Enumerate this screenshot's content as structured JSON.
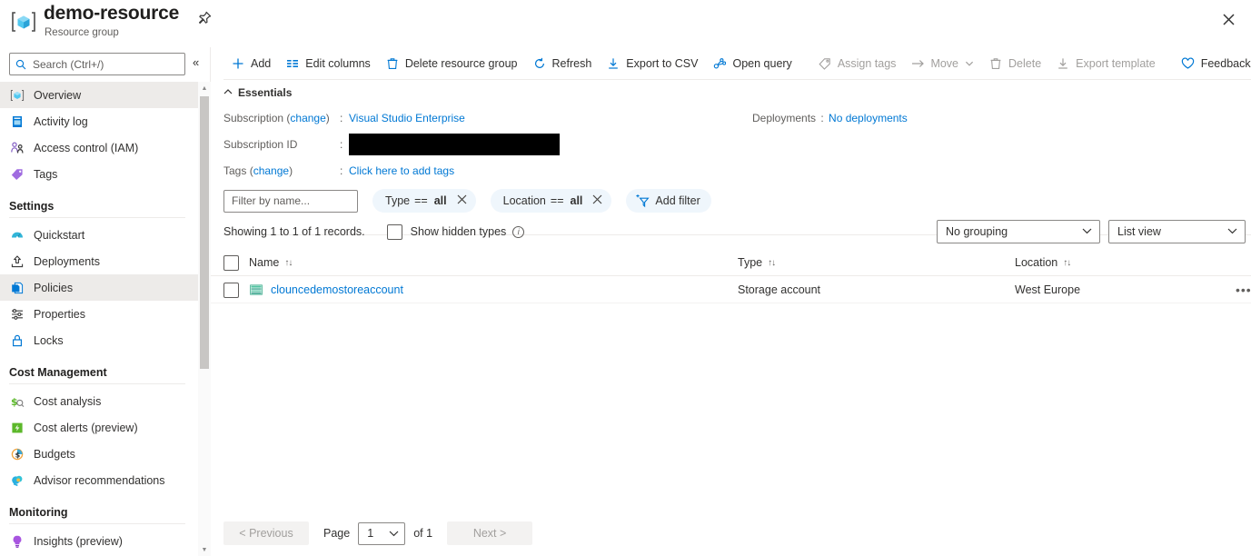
{
  "titlebar": {
    "title": "demo-resource",
    "subtitle": "Resource group",
    "pin_icon": "pin-icon",
    "close_icon": "close-icon",
    "resource_icon": "resource-group-icon"
  },
  "sidebar": {
    "search_placeholder": "Search (Ctrl+/)",
    "search_value": "",
    "collapse_label": "«",
    "items": [
      {
        "label": "Overview",
        "icon": "overview-icon",
        "active": true,
        "type": "item"
      },
      {
        "label": "Activity log",
        "icon": "activity-log-icon",
        "active": false,
        "type": "item"
      },
      {
        "label": "Access control (IAM)",
        "icon": "access-control-icon",
        "active": false,
        "type": "item"
      },
      {
        "label": "Tags",
        "icon": "tags-icon",
        "active": false,
        "type": "item"
      },
      {
        "label": "Settings",
        "type": "group"
      },
      {
        "label": "Quickstart",
        "icon": "quickstart-icon",
        "active": false,
        "type": "item"
      },
      {
        "label": "Deployments",
        "icon": "deployments-icon",
        "active": false,
        "type": "item"
      },
      {
        "label": "Policies",
        "icon": "policies-icon",
        "active": true,
        "type": "item"
      },
      {
        "label": "Properties",
        "icon": "properties-icon",
        "active": false,
        "type": "item"
      },
      {
        "label": "Locks",
        "icon": "locks-icon",
        "active": false,
        "type": "item"
      },
      {
        "label": "Cost Management",
        "type": "group"
      },
      {
        "label": "Cost analysis",
        "icon": "cost-analysis-icon",
        "active": false,
        "type": "item"
      },
      {
        "label": "Cost alerts (preview)",
        "icon": "cost-alerts-icon",
        "active": false,
        "type": "item"
      },
      {
        "label": "Budgets",
        "icon": "budgets-icon",
        "active": false,
        "type": "item"
      },
      {
        "label": "Advisor recommendations",
        "icon": "advisor-icon",
        "active": false,
        "type": "item"
      },
      {
        "label": "Monitoring",
        "type": "group"
      },
      {
        "label": "Insights (preview)",
        "icon": "insights-icon",
        "active": false,
        "type": "item"
      }
    ]
  },
  "toolbar": {
    "commands": [
      {
        "label": "Add",
        "icon": "plus-icon",
        "disabled": false
      },
      {
        "label": "Edit columns",
        "icon": "columns-icon",
        "disabled": false
      },
      {
        "label": "Delete resource group",
        "icon": "trash-icon",
        "disabled": false
      },
      {
        "label": "Refresh",
        "icon": "refresh-icon",
        "disabled": false
      },
      {
        "label": "Export to CSV",
        "icon": "download-icon",
        "disabled": false
      },
      {
        "label": "Open query",
        "icon": "open-query-icon",
        "disabled": false
      },
      {
        "separator": true
      },
      {
        "label": "Assign tags",
        "icon": "tag-icon",
        "disabled": true
      },
      {
        "label": "Move",
        "icon": "arrow-right-icon",
        "disabled": true,
        "caret": true
      },
      {
        "label": "Delete",
        "icon": "trash-icon",
        "disabled": true
      },
      {
        "label": "Export template",
        "icon": "download-icon",
        "disabled": true
      },
      {
        "separator": true
      },
      {
        "label": "Feedback",
        "icon": "heart-icon",
        "disabled": false
      }
    ]
  },
  "essentials": {
    "header": "Essentials",
    "collapse_icon": "chevron-up-icon",
    "rows": [
      {
        "key": "Subscription",
        "change": "change",
        "colon": ":",
        "value": "Visual Studio Enterprise",
        "link": true
      },
      {
        "key": "Subscription ID",
        "colon": ":",
        "value": "",
        "redacted": true
      },
      {
        "key": "Tags",
        "change": "change",
        "colon": ":",
        "value": "Click here to add tags",
        "link": true
      }
    ],
    "right_rows": [
      {
        "key": "Deployments",
        "colon": ":",
        "value": "No deployments",
        "link": true
      }
    ],
    "change_label": "change"
  },
  "filters": {
    "name_placeholder": "Filter by name...",
    "name_value": "",
    "pills": [
      {
        "field": "Type",
        "op": "==",
        "value": "all",
        "close_icon": "close-icon"
      },
      {
        "field": "Location",
        "op": "==",
        "value": "all",
        "close_icon": "close-icon"
      }
    ],
    "add_filter_label": "Add filter",
    "add_filter_icon": "add-filter-icon"
  },
  "records": {
    "showing_text": "Showing 1 to 1 of 1 records.",
    "show_hidden_label": "Show hidden types",
    "show_hidden_checked": false,
    "info_icon": "info-icon",
    "grouping_value": "No grouping",
    "view_value": "List view"
  },
  "table": {
    "columns": [
      {
        "label": "Name",
        "sort_icon": "sort-icon"
      },
      {
        "label": "Type",
        "sort_icon": "sort-icon"
      },
      {
        "label": "Location",
        "sort_icon": "sort-icon"
      }
    ],
    "sort_glyph": "↑↓",
    "rows": [
      {
        "name": "clouncedemostoreaccount",
        "type": "Storage account",
        "location": "West Europe",
        "icon": "storage-account-icon",
        "more_icon": "ellipsis-icon",
        "more_glyph": "•••"
      }
    ]
  },
  "pagination": {
    "previous_label": "< Previous",
    "page_label": "Page",
    "page_value": "1",
    "of_label": "of 1",
    "next_label": "Next >"
  },
  "colors": {
    "accent": "#0078d4",
    "pill_bg": "#eff6fc",
    "disabled": "#a19f9d",
    "border": "#edebe9"
  }
}
